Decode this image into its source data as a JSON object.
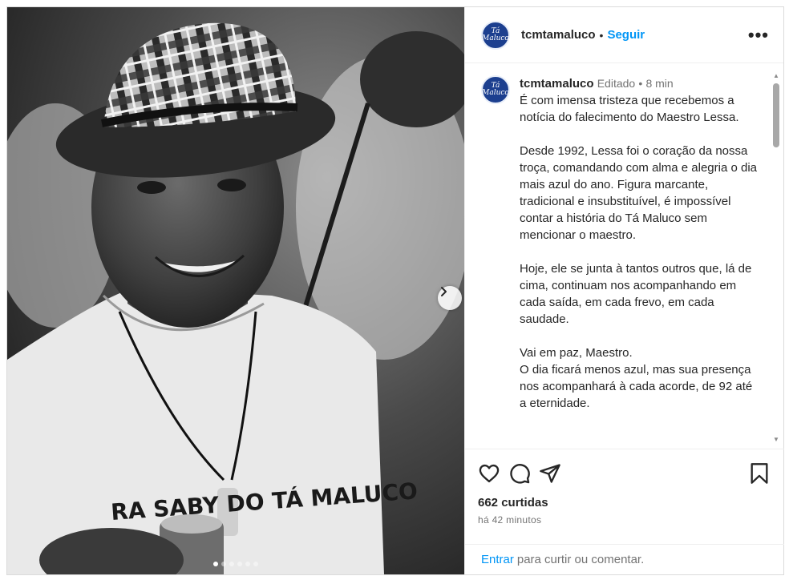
{
  "post": {
    "username": "tcmtamaluco",
    "avatar_text": "Tá Maluco",
    "separator": "•",
    "follow_label": "Seguir",
    "more_label": "•••",
    "edited_label": "Editado",
    "meta_separator": "•",
    "posted_ago": "8 min",
    "caption": [
      "É com imensa tristeza que recebemos a notícia do falecimento do Maestro Lessa.",
      "Desde 1992, Lessa foi o coração da nossa troça, comandando com alma e alegria o dia mais azul do ano. Figura marcante, tradicional e insubstituível, é impossível contar a história do Tá Maluco sem mencionar o maestro.",
      "Hoje, ele se junta à tantos outros que, lá de cima, continuam nos acompanhando em cada saída, em cada frevo, em cada saudade.",
      "Vai em paz, Maestro.\nO dia ficará menos azul, mas sua presença nos acompanhará à cada acorde, de 92 até a eternidade."
    ],
    "likes": "662 curtidas",
    "timestamp": "há 42 minutos",
    "comment_login_link": "Entrar",
    "comment_prompt": "para curtir ou comentar."
  },
  "icons": {
    "like": "heart-icon",
    "comment": "comment-icon",
    "share": "share-icon",
    "save": "bookmark-icon",
    "next": "chevron-right-icon"
  },
  "carousel": {
    "slide_count": 6,
    "active_index": 0
  },
  "colors": {
    "link": "#0095f6",
    "avatar_bg": "#1c3f8f",
    "muted": "#737373"
  }
}
